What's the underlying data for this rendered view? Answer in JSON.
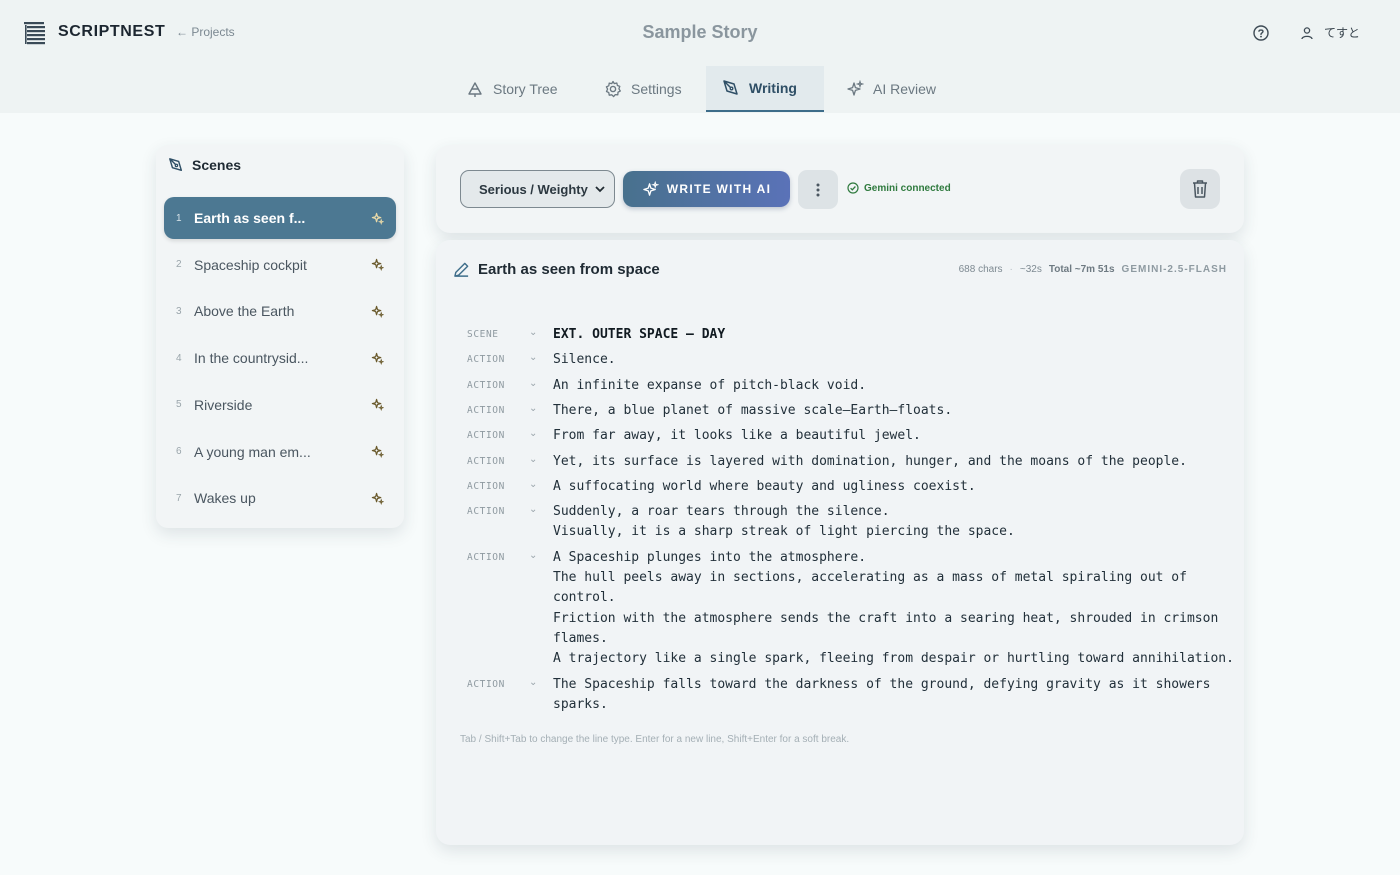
{
  "header": {
    "app_name": "SCRIPTNEST",
    "back_link": "← Projects",
    "title": "Sample Story",
    "user_name": "てすと"
  },
  "tabs": [
    {
      "label": "Story Tree",
      "icon": "tree-icon",
      "active": false
    },
    {
      "label": "Settings",
      "icon": "gear-icon",
      "active": false
    },
    {
      "label": "Writing",
      "icon": "pen-nib-icon",
      "active": true
    },
    {
      "label": "AI Review",
      "icon": "sparkle-icon",
      "active": false
    }
  ],
  "scenes": {
    "heading": "Scenes",
    "items": [
      {
        "num": "1",
        "name": "Earth as seen f...",
        "active": true
      },
      {
        "num": "2",
        "name": "Spaceship cockpit"
      },
      {
        "num": "3",
        "name": "Above the Earth"
      },
      {
        "num": "4",
        "name": "In the countrysid..."
      },
      {
        "num": "5",
        "name": "Riverside"
      },
      {
        "num": "6",
        "name": "A young man em..."
      },
      {
        "num": "7",
        "name": "Wakes up"
      }
    ]
  },
  "toolbar": {
    "tone_selected": "Serious / Weighty",
    "write_ai_label": "WRITE WITH AI",
    "status_text": "Gemini connected"
  },
  "editor": {
    "scene_title": "Earth as seen from space",
    "chars": "688 chars",
    "duration": "~32s",
    "total": "Total ~7m 51s",
    "model": "GEMINI-2.5-FLASH",
    "lines": [
      {
        "type": "SCENE",
        "text": "EXT. OUTER SPACE – DAY"
      },
      {
        "type": "ACTION",
        "text": "Silence."
      },
      {
        "type": "ACTION",
        "text": "An infinite expanse of pitch-black void."
      },
      {
        "type": "ACTION",
        "text": "There, a blue planet of massive scale—Earth—floats."
      },
      {
        "type": "ACTION",
        "text": "From far away, it looks like a beautiful jewel."
      },
      {
        "type": "ACTION",
        "text": "Yet, its surface is layered with domination, hunger, and the moans of the people."
      },
      {
        "type": "ACTION",
        "text": "A suffocating world where beauty and ugliness coexist."
      },
      {
        "type": "ACTION",
        "text": "Suddenly, a roar tears through the silence.\nVisually, it is a sharp streak of light piercing the space."
      },
      {
        "type": "ACTION",
        "text": "A Spaceship plunges into the atmosphere.\nThe hull peels away in sections, accelerating as a mass of metal spiraling out of\ncontrol.\nFriction with the atmosphere sends the craft into a searing heat, shrouded in crimson\nflames.\nA trajectory like a single spark, fleeing from despair or hurtling toward annihilation."
      },
      {
        "type": "ACTION",
        "text": "The Spaceship falls toward the darkness of the ground, defying gravity as it showers\nsparks."
      }
    ],
    "hint": "Tab / Shift+Tab to change the line type. Enter for a new line, Shift+Enter for a soft break."
  }
}
